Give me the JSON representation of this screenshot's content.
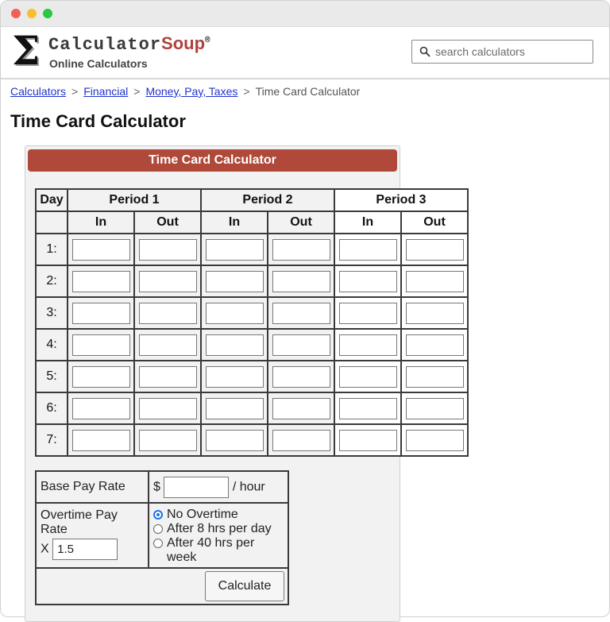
{
  "site": {
    "logo_sigma": "Σ",
    "logo_name": "Calculator",
    "logo_brand": "Soup",
    "logo_reg": "®",
    "tagline": "Online Calculators"
  },
  "search": {
    "placeholder": "search calculators",
    "icon": "search-icon"
  },
  "breadcrumb": {
    "items": [
      "Calculators",
      "Financial",
      "Money, Pay, Taxes",
      "Time Card Calculator"
    ],
    "separator": ">"
  },
  "page": {
    "title": "Time Card Calculator"
  },
  "calculator": {
    "header": "Time Card Calculator",
    "header_color": "#b0493a",
    "table": {
      "day_header": "Day",
      "periods": [
        "Period 1",
        "Period 2",
        "Period 3"
      ],
      "in_label": "In",
      "out_label": "Out",
      "days": [
        "1:",
        "2:",
        "3:",
        "4:",
        "5:",
        "6:",
        "7:"
      ]
    },
    "pay": {
      "base_label": "Base Pay Rate",
      "currency": "$",
      "per_unit": "/ hour",
      "base_value": "",
      "overtime_label": "Overtime Pay Rate",
      "multiplier_label": "X",
      "multiplier_value": "1.5",
      "overtime_options": [
        "No Overtime",
        "After 8 hrs per day",
        "After 40 hrs per week"
      ],
      "selected_option": "No Overtime"
    },
    "calculate_label": "Calculate"
  }
}
